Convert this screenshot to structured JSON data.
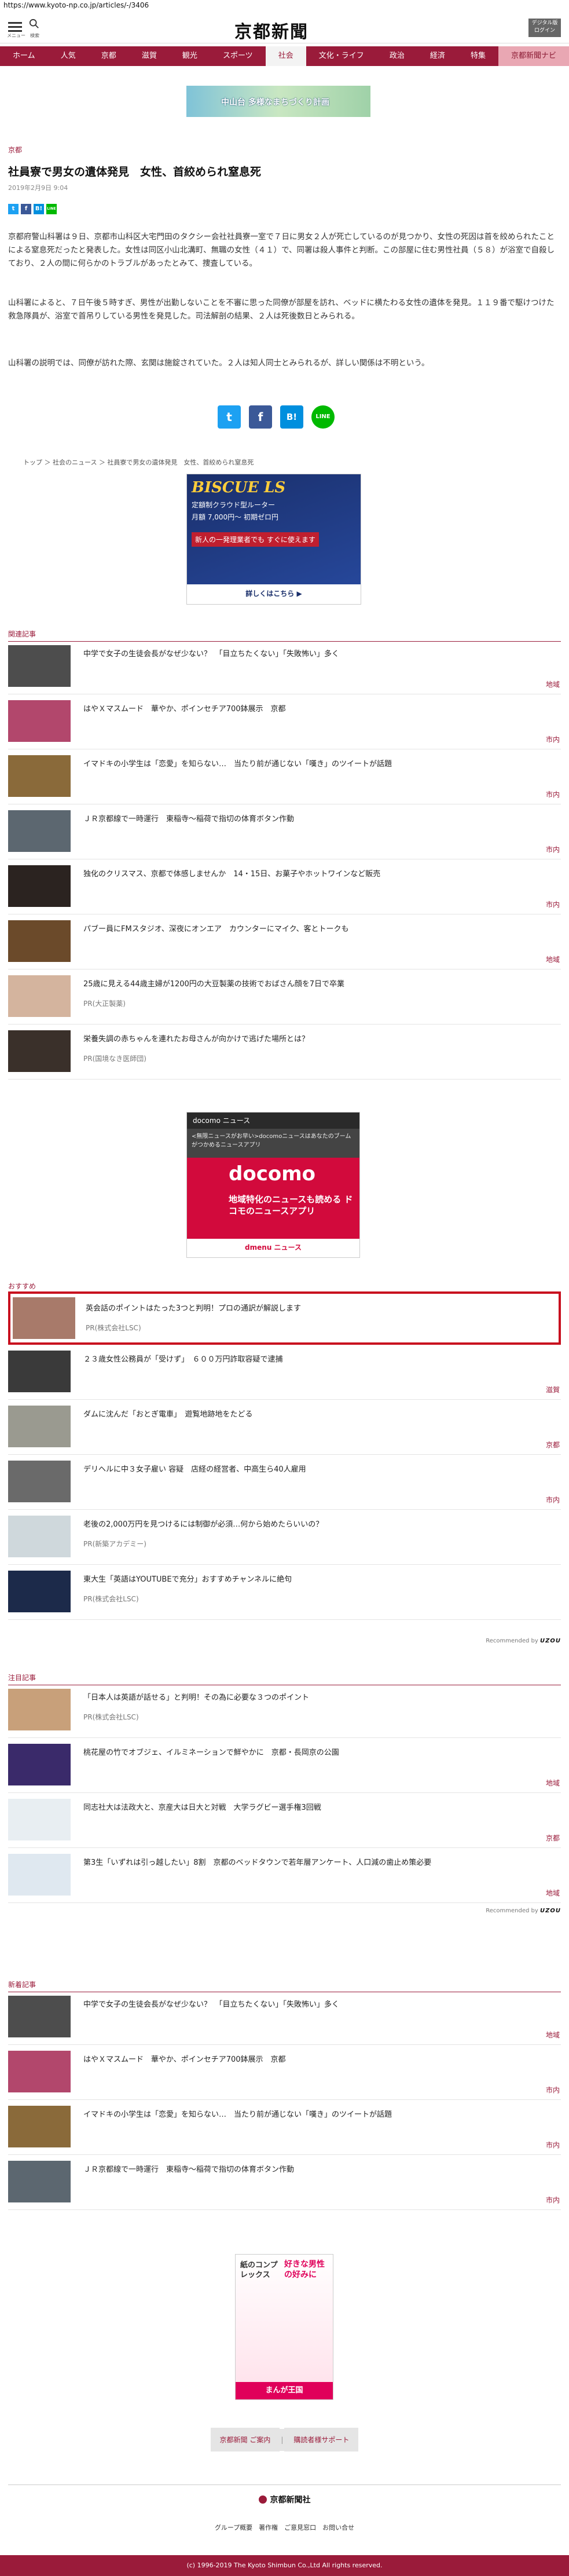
{
  "browser": {
    "url": "https://www.kyoto-np.co.jp/articles/-/3406"
  },
  "header": {
    "menu_caption": "メニュー",
    "search_caption": "検索",
    "logo": "京都新聞",
    "digital_label": "デジタル版",
    "digital_sub": "ログイン"
  },
  "nav": {
    "items": [
      "ホーム",
      "人気",
      "京都",
      "滋賀",
      "観光",
      "スポーツ",
      "社会",
      "文化・ライフ",
      "政治",
      "経済",
      "特集",
      "京都新聞ナビ"
    ]
  },
  "top_banner": {
    "text": "中山台 多様なまちづくり計画"
  },
  "article": {
    "category": "京都",
    "title": "社員寮で男女の遺体発見　女性、首絞められ窒息死",
    "date": "2019年2月9日 9:04",
    "paragraphs": [
      "京都府警山科署は９日、京都市山科区大宅門田のタクシー会社社員寮一室で７日に男女２人が死亡しているのが見つかり、女性の死因は首を絞められたことによる窒息死だったと発表した。女性は同区小山北溝町、無職の女性（４１）で、同署は殺人事件と判断。この部屋に住む男性社員（５８）が浴室で自殺しており、２人の間に何らかのトラブルがあったとみて、捜査している。",
      "山科署によると、７日午後５時すぎ、男性が出勤しないことを不審に思った同僚が部屋を訪れ、ベッドに横たわる女性の遺体を発見。１１９番で駆けつけた救急隊員が、浴室で首吊りしている男性を発見した。司法解剖の結果、２人は死後数日とみられる。",
      "山科署の説明では、同僚が訪れた際、玄関は施錠されていた。２人は知人同士とみられるが、詳しい関係は不明という。"
    ],
    "share_labels": [
      "t",
      "f",
      "B!",
      "LINE"
    ]
  },
  "breadcrumb": "トップ ＞ 社会のニュース ＞ 社員寮で男女の遺体発見　女性、首絞められ窒息死",
  "ad1": {
    "brand": "BISCUE LS",
    "line1": "定額制クラウド型ルーター",
    "line2": "月額 7,000円～ 初期ゼロ円",
    "line3": "新人の一発理業者でも すぐに使えます",
    "more": "詳しくはこちら ▶"
  },
  "related": {
    "heading": "関連記事",
    "items": [
      {
        "title": "中学で女子の生徒会長がなぜ少ない？　「目立ちたくない」「失敗怖い」多く",
        "tag": "地域"
      },
      {
        "title": "はやＸマスムード　華やか、ポインセチア700鉢展示　京都",
        "tag": "市内"
      },
      {
        "title": "イマドキの小学生は「恋愛」を知らない…　当たり前が通じない「嘆き」のツイートが話題",
        "tag": "市内"
      },
      {
        "title": "ＪＲ京都線で一時運行　東稲寺～稲荷で指切の体育ボタン作動",
        "tag": "市内"
      },
      {
        "title": "独化のクリスマス、京都で体感しませんか　14・15日、お菓子やホットワインなど販売",
        "tag": "市内"
      },
      {
        "title": "パブー員にFMスタジオ、深夜にオンエア　カウンターにマイク、客とトークも",
        "tag": "地域"
      },
      {
        "title": "25歳に見える44歳主婦が1200円の大豆製薬の技術でおばさん顔を7日で卒業",
        "sub": "PR(大正製薬)"
      },
      {
        "title": "栄養失調の赤ちゃんを連れたお母さんが向かけで逃げた場所とは？",
        "sub": "PR(国境なき医師団)"
      }
    ]
  },
  "ad2": {
    "brand": "docomo ニュース",
    "line1": "<無限ニュースがお早い>docomoニュースはあなたのブームがつかめるニュースアプリ",
    "logo": "docomo",
    "line2": "地域特化のニュースも読める ドコモのニュースアプリ",
    "footer": "dmenu ニュース"
  },
  "recommend": {
    "heading": "おすすめ",
    "items": [
      {
        "title": "英会話のポイントはたった3つと判明！プロの通訳が解説します",
        "sub": "PR(株式会社LSC)"
      },
      {
        "title": "２３歳女性公務員が「受けず」　６００万円詐取容疑で逮捕",
        "tag": "滋賀"
      },
      {
        "title": "ダムに沈んだ「おとぎ電車」　遊覧地跡地をたどる",
        "tag": "京都"
      },
      {
        "title": "デリヘルに中３女子雇い 容疑　店経の経営者、中高生ら40人雇用",
        "tag": "市内"
      },
      {
        "title": "老後の2,000万円を見つけるには制御が必須…何から始めたらいいの？",
        "sub": "PR(新築アカデミー)"
      },
      {
        "title": "東大生「英語はYOUTUBEで充分」おすすめチャンネルに絶句",
        "sub": "PR(株式会社LSC)"
      }
    ],
    "recby": "Recommended by",
    "recby_brand": "UZOU"
  },
  "featured": {
    "heading": "注目記事",
    "items": [
      {
        "title": "「日本人は英語が話せる」と判明！その為に必要な３つのポイント",
        "sub": "PR(株式会社LSC)"
      },
      {
        "title": "桃花屋の竹でオブジェ、イルミネーションで鮮やかに　京都・長岡京の公園",
        "tag": "地域"
      },
      {
        "title": "同志社大は法政大と、京産大は日大と対戦　大学ラグビー選手権3回戦",
        "tag": "京都"
      },
      {
        "title": "第3生「いずれは引っ越したい」8割　京都のベッドタウンで若年層アンケート、人口減の歯止め策必要",
        "tag": "地域"
      }
    ],
    "recby": "Recommended by",
    "recby_brand": "UZOU"
  },
  "newest": {
    "heading": "新着記事",
    "items": [
      {
        "title": "中学で女子の生徒会長がなぜ少ない？　「目立ちたくない」「失敗怖い」多く",
        "tag": "地域"
      },
      {
        "title": "はやＸマスムード　華やか、ポインセチア700鉢展示　京都",
        "tag": "市内"
      },
      {
        "title": "イマドキの小学生は「恋愛」を知らない…　当たり前が通じない「嘆き」のツイートが話題",
        "tag": "市内"
      },
      {
        "title": "ＪＲ京都線で一時運行　東稲寺～稲荷で指切の体育ボタン作動",
        "tag": "市内"
      }
    ]
  },
  "ad3": {
    "line1": "好きな男性の好みに",
    "line2": "紙のコンプレックス",
    "line3": "まんが王国"
  },
  "footer": {
    "links": [
      "京都新聞 ご案内",
      "購読者様サポート"
    ],
    "logo": "京都新聞社",
    "nav": "グループ概要　著作権　ご意見窓口　お問い合せ",
    "copyright": "(c) 1996-2019 The Kyoto Shimbun Co.,Ltd All rights reserved."
  },
  "colors": {
    "brand": "#9a1b3a",
    "twitter": "#1da1f2",
    "facebook": "#3b5998",
    "hatena": "#008fde",
    "line": "#00b900"
  }
}
